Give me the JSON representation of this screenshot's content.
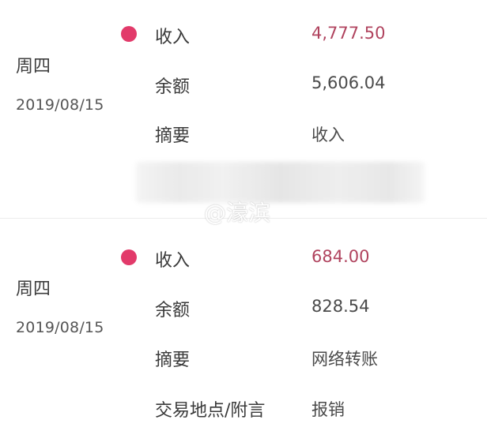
{
  "transactions": [
    {
      "weekday": "周四",
      "date": "2019/08/15",
      "rows": {
        "income_label": "收入",
        "income_value": "4,777.50",
        "balance_label": "余额",
        "balance_value": "5,606.04",
        "summary_label": "摘要",
        "summary_value": "收入"
      }
    },
    {
      "weekday": "周四",
      "date": "2019/08/15",
      "rows": {
        "income_label": "收入",
        "income_value": "684.00",
        "balance_label": "余额",
        "balance_value": "828.54",
        "summary_label": "摘要",
        "summary_value": "网络转账",
        "location_label": "交易地点/附言",
        "location_value": "报销"
      }
    }
  ],
  "watermark": "@濠滨",
  "colors": {
    "income_dot": "#e23a6a",
    "income_amount": "#b0435e"
  }
}
